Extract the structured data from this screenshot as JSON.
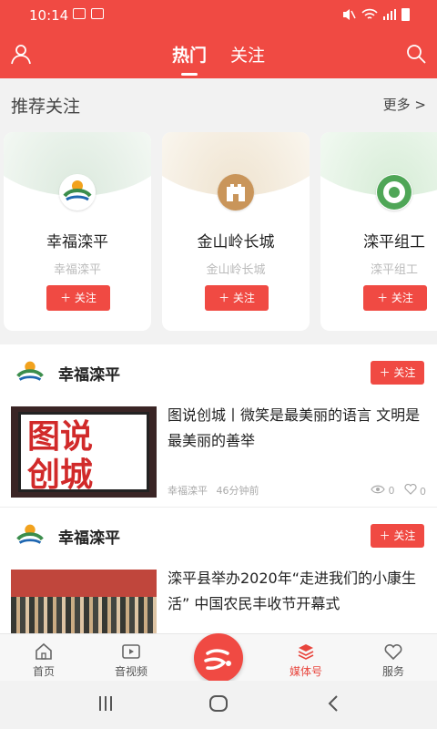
{
  "status": {
    "time": "10:14"
  },
  "header": {
    "tabs": [
      {
        "label": "热门"
      },
      {
        "label": "关注"
      }
    ],
    "user_icon": "user-icon",
    "search_icon": "search-icon"
  },
  "recommend": {
    "title": "推荐关注",
    "more": "更多 >",
    "cards": [
      {
        "name": "幸福滦平",
        "sub": "幸福滦平",
        "follow": "关注",
        "accent": "#5c8f6a"
      },
      {
        "name": "金山岭长城",
        "sub": "金山岭长城",
        "follow": "关注",
        "accent": "#c9a36b"
      },
      {
        "name": "滦平组工",
        "sub": "滦平组工",
        "follow": "关注",
        "accent": "#5faa63"
      }
    ]
  },
  "feed": [
    {
      "author": "幸福滦平",
      "follow": "关注",
      "title": "图说创城丨微笑是最美丽的语言 文明是最美丽的善举",
      "source": "幸福滦平",
      "time": "46分钟前",
      "views": "0",
      "likes": "0",
      "thumb_text": [
        "图说",
        "创城"
      ]
    },
    {
      "author": "幸福滦平",
      "follow": "关注",
      "title": "滦平县举办2020年“走进我们的小康生活” 中国农民丰收节开幕式"
    }
  ],
  "nav": [
    {
      "label": "首页",
      "icon": "home-icon"
    },
    {
      "label": "音视频",
      "icon": "video-icon"
    },
    {
      "label": "",
      "icon": "app-logo-icon"
    },
    {
      "label": "媒体号",
      "icon": "media-icon"
    },
    {
      "label": "服务",
      "icon": "service-icon"
    }
  ],
  "colors": {
    "brand": "#f04a43"
  }
}
